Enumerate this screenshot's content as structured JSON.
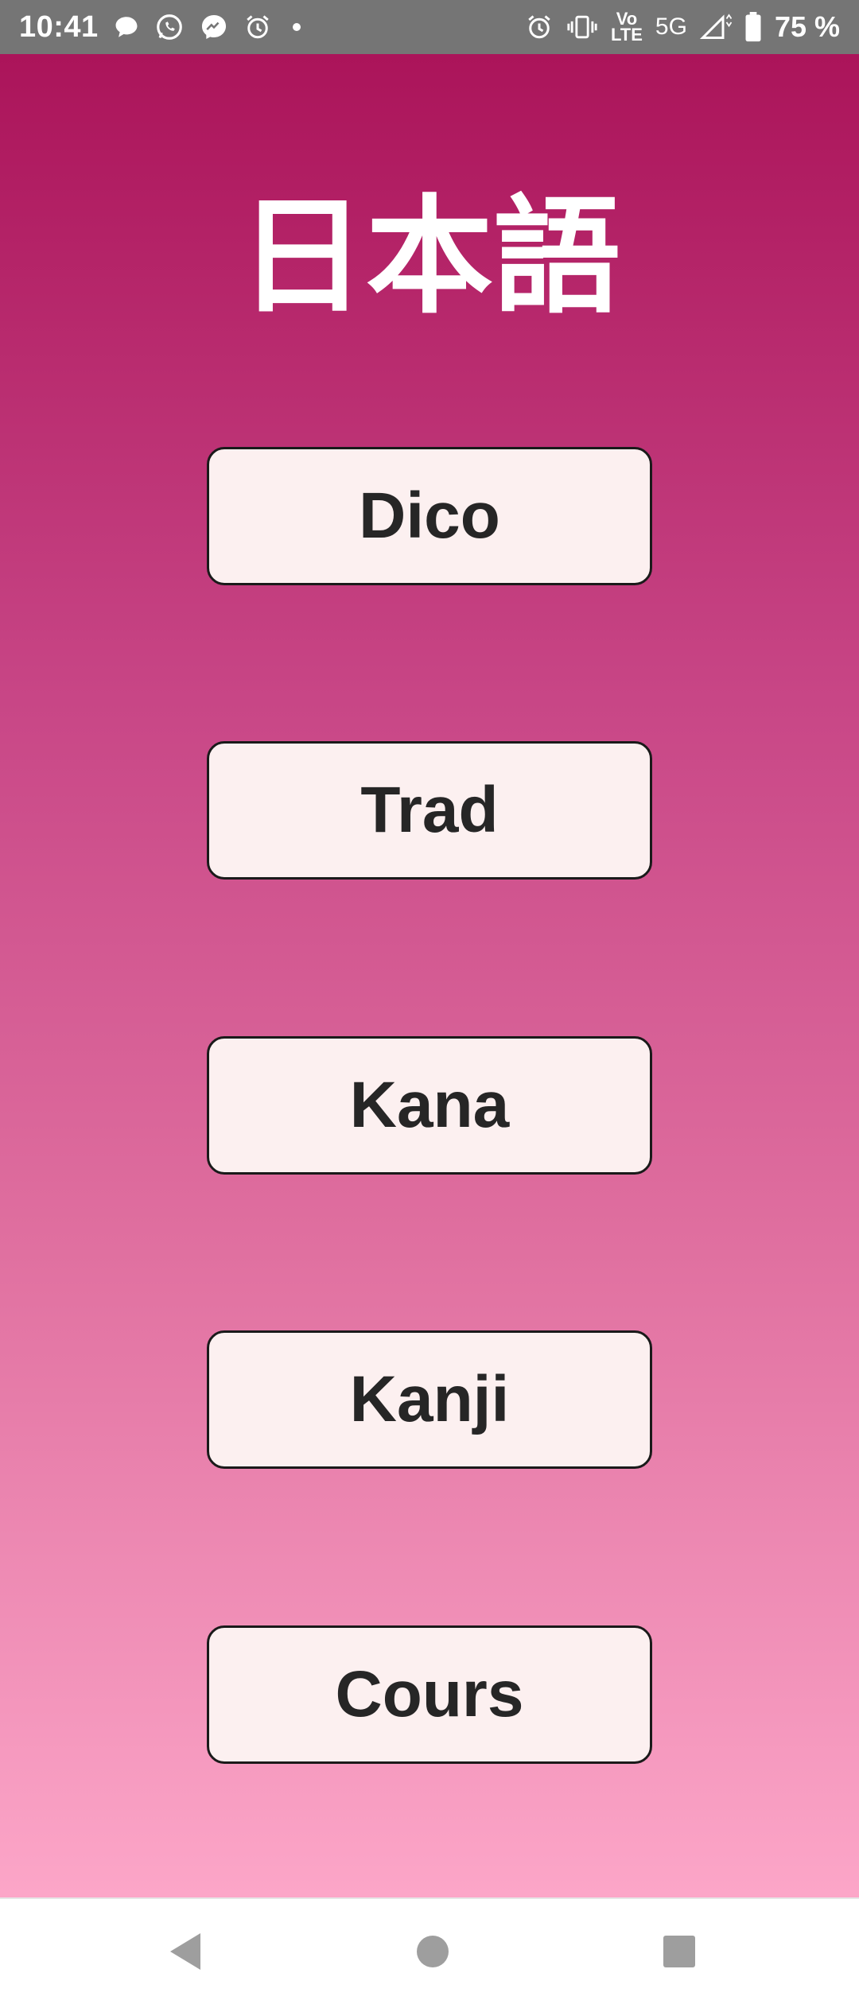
{
  "status_bar": {
    "time": "10:41",
    "network_top": "Vo",
    "network_bottom": "LTE",
    "network_type": "5G",
    "battery": "75 %",
    "left_icons": [
      "chat-bubble-icon",
      "whatsapp-icon",
      "messenger-icon",
      "alarm-icon",
      "notification-dot-icon"
    ],
    "right_icons": [
      "alarm-icon",
      "vibrate-icon",
      "volte-icon",
      "signal-icon",
      "battery-icon"
    ]
  },
  "app": {
    "title": "日本語",
    "buttons": [
      {
        "label": "Dico"
      },
      {
        "label": "Trad"
      },
      {
        "label": "Kana"
      },
      {
        "label": "Kanji"
      },
      {
        "label": "Cours"
      }
    ]
  },
  "nav_bar": {
    "icons": [
      "back-icon",
      "home-icon",
      "recents-icon"
    ]
  },
  "colors": {
    "gradient_top": "#ab145a",
    "gradient_bottom": "#fca6c8",
    "button_bg": "#fcf0f0",
    "button_text": "#262626",
    "status_bar": "#757575"
  }
}
